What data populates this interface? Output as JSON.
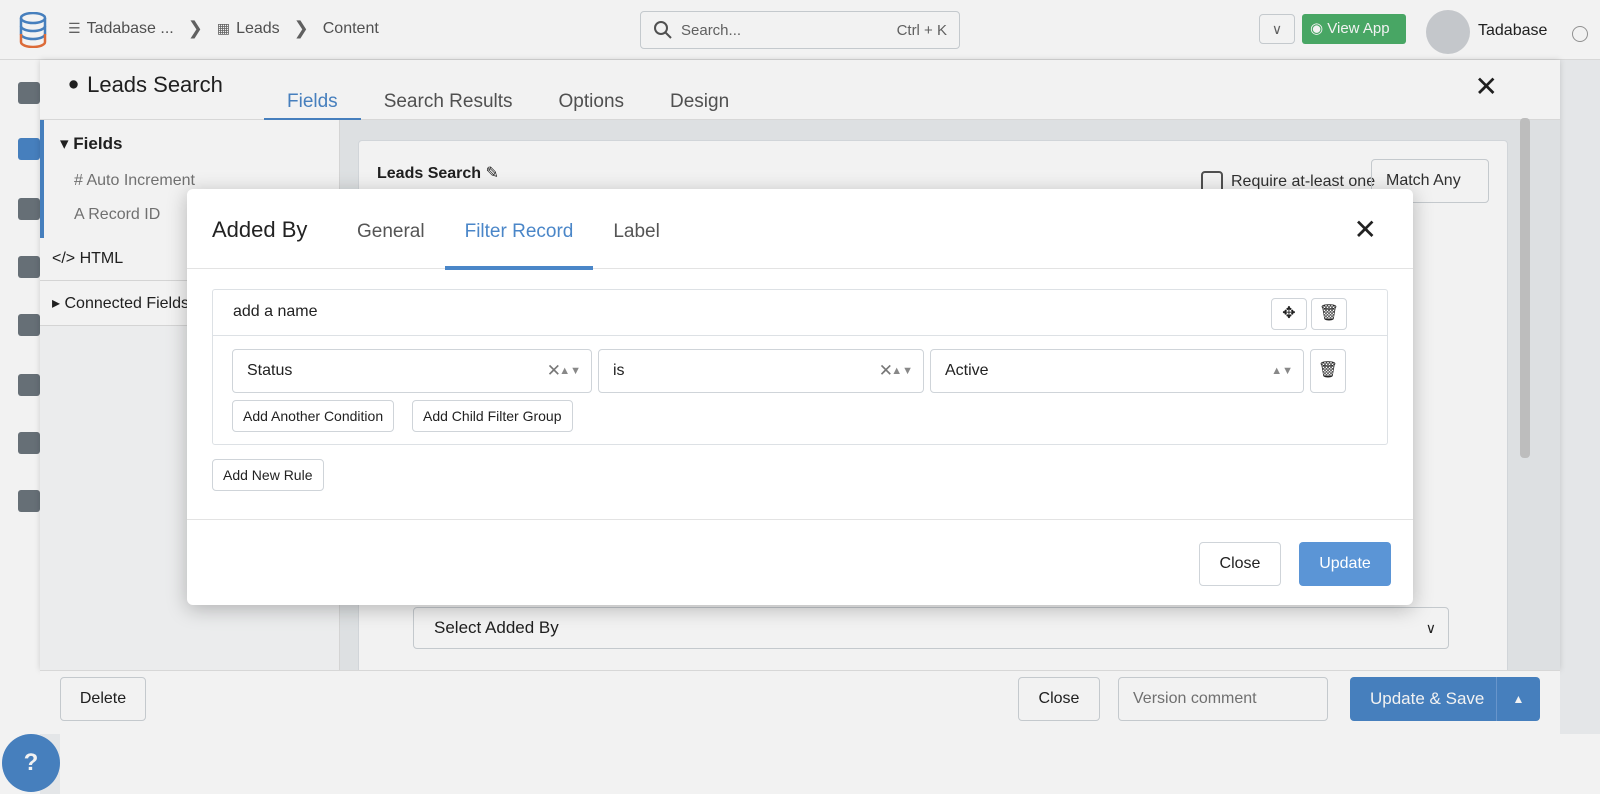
{
  "topbar": {
    "breadcrumbs": [
      "Tadabase ...",
      "Leads",
      "Content"
    ],
    "search_placeholder": "Search...",
    "search_shortcut": "Ctrl + K",
    "view_app_label": "View App",
    "username": "Tadabase"
  },
  "editor": {
    "title": "Leads Search",
    "tabs": [
      "Fields",
      "Search Results",
      "Options",
      "Design"
    ],
    "active_tab": "Fields",
    "sidebar": {
      "section_title": "Fields",
      "items": [
        "Auto Increment",
        "Record ID"
      ],
      "html_label": "HTML",
      "connected_label": "Connected Fields"
    },
    "card_title": "Leads Search",
    "require_label": "Require at-least one",
    "match_value": "Match Any",
    "select_added_by": "Select Added By"
  },
  "footer": {
    "delete_label": "Delete",
    "close_label": "Close",
    "version_placeholder": "Version comment",
    "update_save_label": "Update & Save"
  },
  "modal": {
    "title": "Added By",
    "tabs": [
      "General",
      "Filter Record",
      "Label"
    ],
    "active_tab": "Filter Record",
    "rule_name_placeholder": "add a name",
    "condition": {
      "field": "Status",
      "operator": "is",
      "value": "Active"
    },
    "add_condition_label": "Add Another Condition",
    "add_child_group_label": "Add Child Filter Group",
    "add_rule_label": "Add New Rule",
    "close_label": "Close",
    "update_label": "Update"
  },
  "colors": {
    "accent": "#4a86c8",
    "view_app_green": "#4caf6a"
  },
  "help_label": "?"
}
